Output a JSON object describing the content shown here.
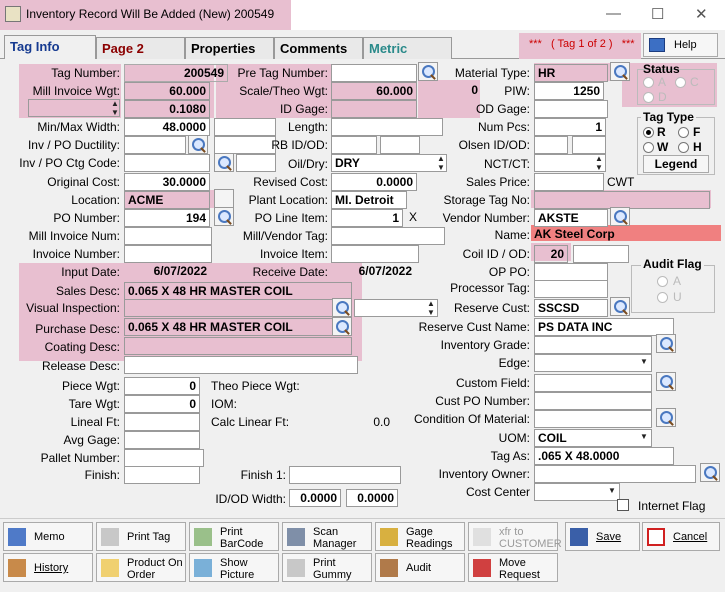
{
  "window": {
    "title": "Inventory Record Will Be Added  (New) 200549"
  },
  "tabs": [
    "Tag Info",
    "Page 2",
    "Properties",
    "Comments",
    "Metric"
  ],
  "tag_indicator": "***   ( Tag 1 of 2 )   ***",
  "help_label": "Help",
  "left": {
    "tag_number_label": "Tag Number:",
    "tag_number": "200549",
    "mill_invoice_wgt_label": "Mill Invoice Wgt:",
    "mill_invoice_wgt": "60.000",
    "row3_value": "0.1080",
    "minmax_width_label": "Min/Max Width:",
    "min_width": "48.0000",
    "inv_po_ductility_label": "Inv / PO Ductility:",
    "inv_po_ctg_code_label": "Inv / PO Ctg Code:",
    "original_cost_label": "Original Cost:",
    "original_cost": "30.0000",
    "location_label": "Location:",
    "location": "ACME",
    "po_number_label": "PO Number:",
    "po_number": "194",
    "mill_invoice_num_label": "Mill Invoice Num:",
    "invoice_number_label": "Invoice Number:",
    "input_date_label": "Input Date:",
    "input_date": "6/07/2022",
    "sales_desc_label": "Sales Desc:",
    "sales_desc": "0.065 X 48 HR MASTER COIL",
    "visual_inspection_label": "Visual Inspection:",
    "purchase_desc_label": "Purchase Desc:",
    "purchase_desc": "0.065 X 48 HR MASTER COIL",
    "coating_desc_label": "Coating Desc:",
    "release_desc_label": "Release Desc:",
    "piece_wgt_label": "Piece Wgt:",
    "piece_wgt": "0",
    "tare_wgt_label": "Tare Wgt:",
    "tare_wgt": "0",
    "lineal_ft_label": "Lineal Ft:",
    "avg_gage_label": "Avg Gage:",
    "pallet_number_label": "Pallet Number:",
    "finish_label": "Finish:"
  },
  "middle": {
    "pre_tag_number_label": "Pre Tag Number:",
    "scale_theo_wgt_label": "Scale/Theo Wgt:",
    "scale_wgt": "60.000",
    "theo_wgt": "0",
    "id_gage_label": "ID Gage:",
    "length_label": "Length:",
    "rb_idod_label": "RB ID/OD:",
    "oil_dry_label": "Oil/Dry:",
    "oil_dry": "DRY",
    "revised_cost_label": "Revised Cost:",
    "revised_cost": "0.0000",
    "plant_location_label": "Plant Location:",
    "plant_location": "MI. Detroit",
    "po_line_item_label": "PO Line Item:",
    "po_line_item": "1",
    "po_line_x": "X",
    "mill_vendor_tag_label": "Mill/Vendor Tag:",
    "invoice_item_label": "Invoice Item:",
    "receive_date_label": "Receive Date:",
    "receive_date": "6/07/2022",
    "theo_piece_wgt_label": "Theo Piece Wgt:",
    "iom_label": "IOM:",
    "calc_linear_ft_label": "Calc Linear Ft:",
    "calc_linear_ft": "0.0",
    "finish1_label": "Finish 1:",
    "idod_width_label": "ID/OD Width:",
    "idod_width_1": "0.0000",
    "idod_width_2": "0.0000"
  },
  "right": {
    "material_type_label": "Material Type:",
    "material_type": "HR",
    "piw_label": "PIW:",
    "piw": "1250",
    "od_gage_label": "OD Gage:",
    "num_pcs_label": "Num Pcs:",
    "num_pcs": "1",
    "olsen_idod_label": "Olsen ID/OD:",
    "nct_ct_label": "NCT/CT:",
    "sales_price_label": "Sales Price:",
    "sales_price_unit": "CWT",
    "storage_tag_no_label": "Storage Tag No:",
    "vendor_number_label": "Vendor Number:",
    "vendor_number": "AKSTE",
    "name_label": "Name:",
    "vendor_name": "AK Steel Corp",
    "coil_idod_label": "Coil ID / OD:",
    "coil_id": "20",
    "op_po_label": "OP PO:",
    "processor_tag_label": "Processor Tag:",
    "reserve_cust_label": "Reserve Cust:",
    "reserve_cust": "SSCSD",
    "reserve_cust_name_label": "Reserve Cust Name:",
    "reserve_cust_name": "PS DATA INC",
    "inventory_grade_label": "Inventory Grade:",
    "edge_label": "Edge:",
    "custom_field_label": "Custom Field:",
    "cust_po_number_label": "Cust PO Number:",
    "condition_of_material_label": "Condition Of Material:",
    "uom_label": "UOM:",
    "uom": "COIL",
    "tag_as_label": "Tag As:",
    "tag_as": ".065 X 48.0000",
    "inventory_owner_label": "Inventory Owner:",
    "cost_center_label": "Cost Center",
    "internet_flag_label": "Internet Flag"
  },
  "status_group": {
    "title": "Status",
    "options": [
      "A",
      "C",
      "D"
    ]
  },
  "tag_type_group": {
    "title": "Tag Type",
    "options": [
      "R",
      "F",
      "W",
      "H"
    ],
    "selected": "R",
    "legend_label": "Legend"
  },
  "audit_flag_group": {
    "title": "Audit Flag",
    "options": [
      "A",
      "U"
    ]
  },
  "buttons_row1": [
    "Memo",
    "Print Tag",
    "Print\nBarCode",
    "Scan\nManager",
    "Gage\nReadings",
    "xfr to\nCUSTOMER",
    "Save",
    "Cancel"
  ],
  "buttons_row2": [
    "History",
    "Product On\nOrder",
    "Show\nPicture",
    "Print\nGummy",
    "Audit",
    "Move\nRequest"
  ],
  "colors": {
    "highlight": "#e8bfd0",
    "vendor_name_bg": "#f08080",
    "tag_indicator": "#cc0000"
  }
}
